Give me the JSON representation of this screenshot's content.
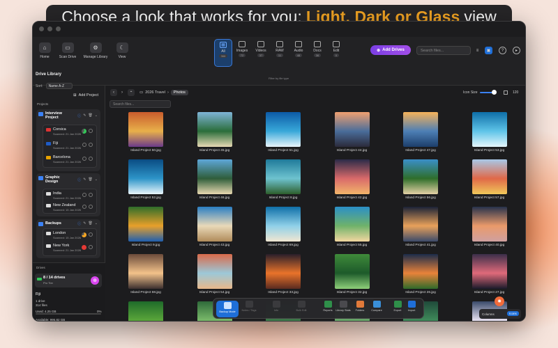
{
  "banner": {
    "plain": "Choose a look that works for you; ",
    "highlight": "Light, Dark or Glass",
    "suffix": "view"
  },
  "toolbar": {
    "home": "Home",
    "scan": "Scan Drive",
    "manage": "Manage Library",
    "view": "View",
    "filters": [
      {
        "label": "All",
        "count": "366"
      },
      {
        "label": "Images",
        "count": "72"
      },
      {
        "label": "Videos",
        "count": "37"
      },
      {
        "label": "RAW",
        "count": "11"
      },
      {
        "label": "Audio",
        "count": "48"
      },
      {
        "label": "Docs",
        "count": "36"
      },
      {
        "label": "Edit",
        "count": "0"
      }
    ],
    "filter_caption": "Filter by file type",
    "add_drives": "Add Drives",
    "search_placeholder": "Search files..."
  },
  "sidebar": {
    "title": "Drive Library",
    "sort_label": "Sort:",
    "sort_value": "Name A-Z",
    "add_project": "Add Project",
    "projects_label": "Projects",
    "groups": [
      {
        "name": "Interview Project",
        "items": [
          {
            "name": "Corsica",
            "date": "Scanned: 21 Jan 2026"
          },
          {
            "name": "Fiji",
            "date": "Scanned: 21 Jan 2026"
          },
          {
            "name": "Barcelona",
            "date": "Scanned: 21 Jan 2026"
          }
        ]
      },
      {
        "name": "Graphic Design",
        "items": [
          {
            "name": "India",
            "date": "Scanned: 21 Jan 2026"
          },
          {
            "name": "New Zealand",
            "date": "Scanned: 15 Jan 2026"
          }
        ]
      },
      {
        "name": "Backups",
        "items": [
          {
            "name": "London",
            "date": "Scanned: 15 Jan 2026"
          },
          {
            "name": "New York",
            "date": "Scanned: 21 Jan 2026"
          }
        ]
      }
    ],
    "drives_label": "Drives",
    "drive_count": "8 / 14 drives",
    "tier": "Pro Tier",
    "drive_name": "Fiji",
    "drive_num": "1 drive",
    "files": "314 files",
    "used": "Used: 4.25 GB",
    "used_pct": "0%",
    "available": "Available: 995.82 GB"
  },
  "content": {
    "crumb_root": "2026 Travel",
    "crumb_current": "Photos",
    "icon_size_label": "Icon Size",
    "icon_size_value": "120",
    "search_placeholder": "Search files...",
    "files": [
      "Island Project 50.jpg",
      "Island Project 45.jpg",
      "Island Project 51.jpg",
      "Island Project 44.jpg",
      "Island Project 47.jpg",
      "Island Project 53.jpg",
      "Island Project 52.jpg",
      "Island Project 46.jpg",
      "Island Project 8.jpg",
      "Island Project 42.jpg",
      "Island Project 56.jpg",
      "Island Project 57.jpg",
      "Island Project 9.jpg",
      "Island Project 43.jpg",
      "Island Project 69.jpg",
      "Island Project 55.jpg",
      "Island Project 41.jpg",
      "Island Project 40.jpg",
      "Island Project 68.jpg",
      "Island Project 54.jpg",
      "Island Project 33.jpg",
      "Island Project 32.jpg",
      "Island Project 26.jpg",
      "Island Project 27.jpg",
      "",
      "",
      "",
      "",
      "",
      ""
    ]
  },
  "dock": {
    "items": [
      "Backup Mode",
      "Notes / Tags",
      "Info",
      "Bulk Edit",
      "Reports",
      "Library Stats",
      "Folders",
      "Compare",
      "Export",
      "Import"
    ],
    "columns": "Columns",
    "icons": "Icons"
  }
}
